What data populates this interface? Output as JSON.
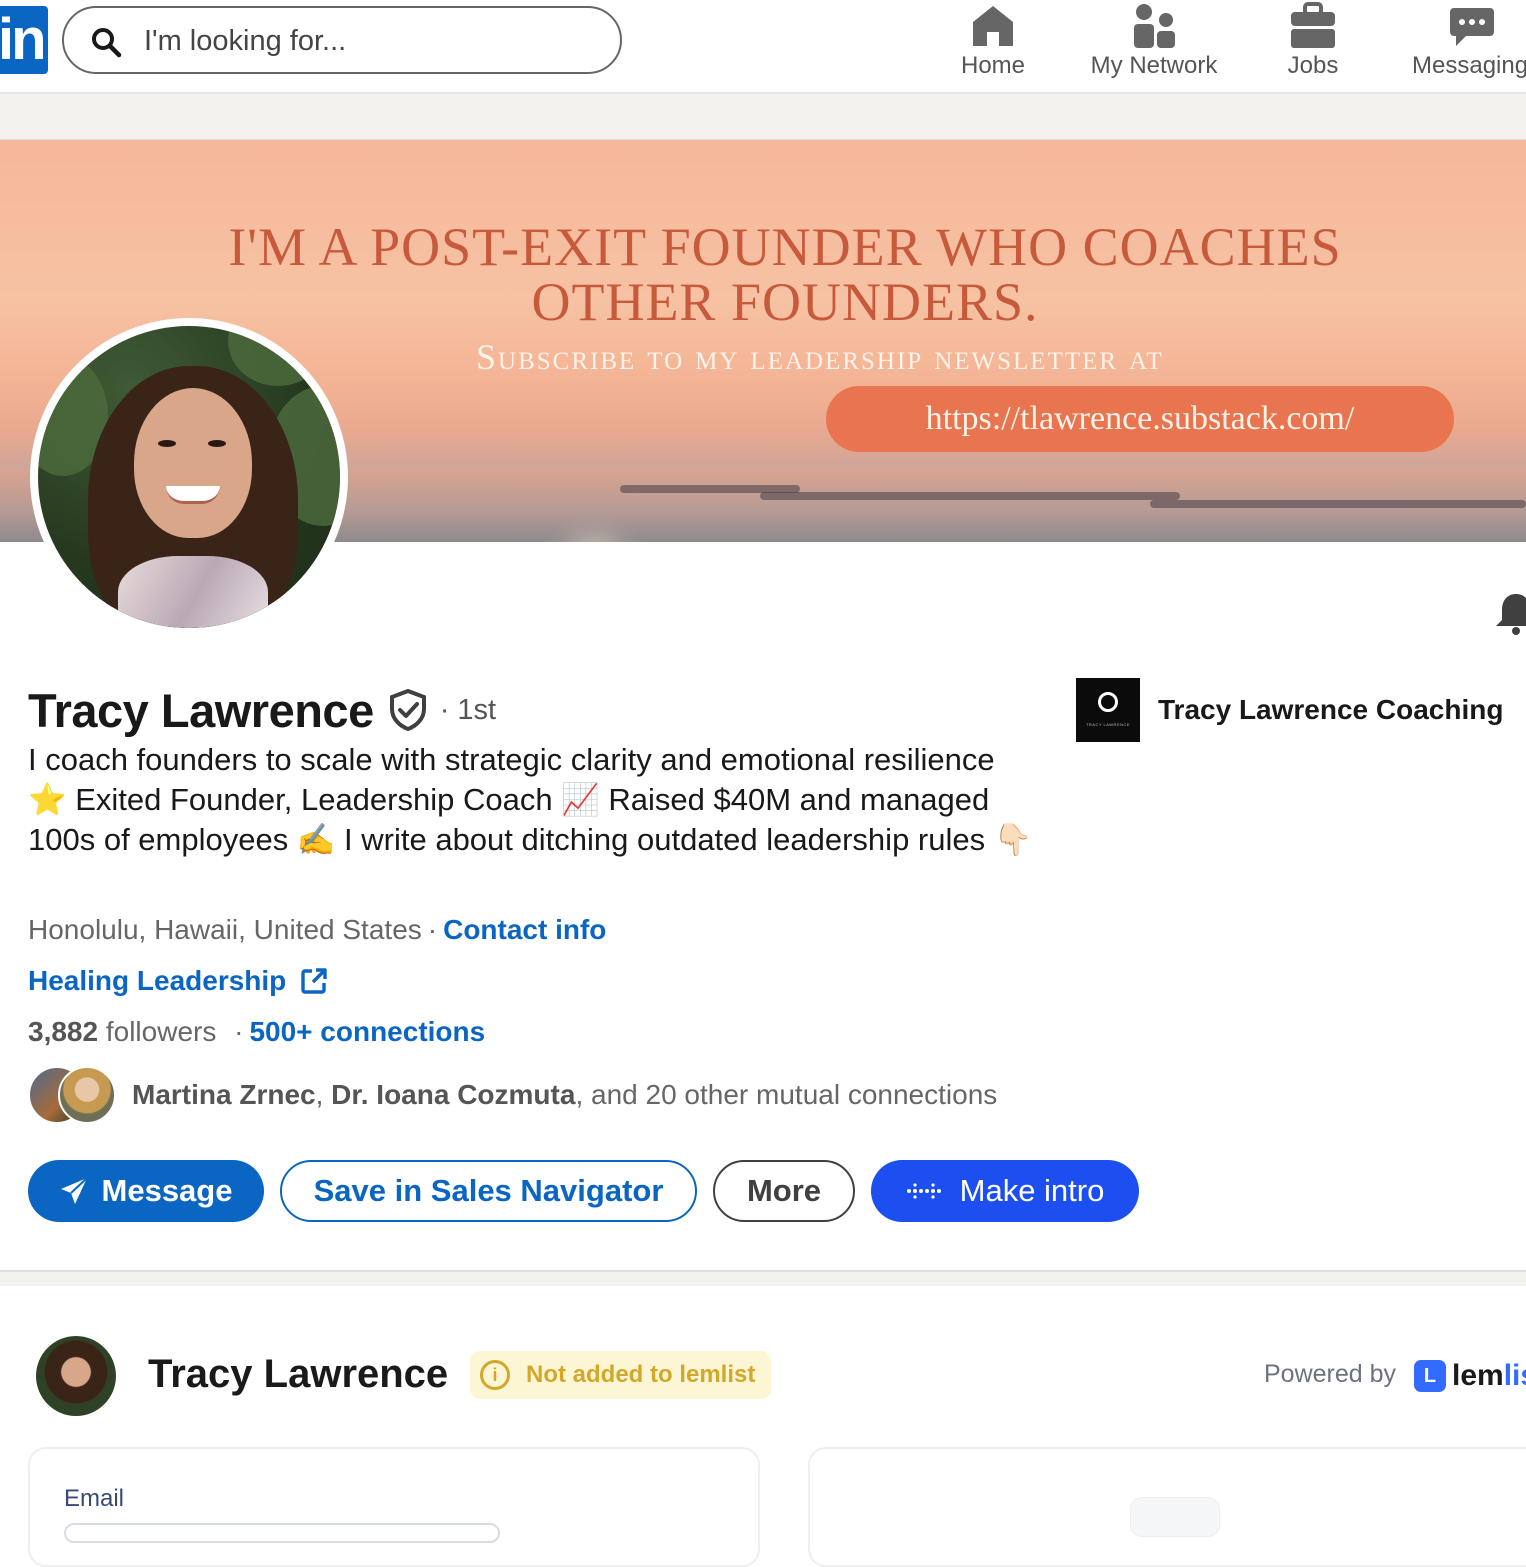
{
  "nav": {
    "logo_text": "in",
    "search_placeholder": "I'm looking for...",
    "items": [
      {
        "label": "Home",
        "icon": "home-icon"
      },
      {
        "label": "My Network",
        "icon": "people-icon"
      },
      {
        "label": "Jobs",
        "icon": "briefcase-icon"
      },
      {
        "label": "Messaging",
        "icon": "chat-bubble-icon"
      }
    ],
    "brand_color": "#0a66c2"
  },
  "banner": {
    "line1": "I'M A POST-EXIT FOUNDER WHO COACHES",
    "line2": "OTHER FOUNDERS.",
    "line3": "Subscribe to my leadership newsletter at",
    "url": "https://tlawrence.substack.com/"
  },
  "profile": {
    "name": "Tracy Lawrence",
    "degree": "· 1st",
    "headline": "I coach founders to scale with strategic clarity and emotional resilience ⭐ Exited Founder, Leadership Coach 📈 Raised $40M and managed 100s of employees ✍️ I write about ditching outdated leadership rules 👇🏻",
    "location": "Honolulu, Hawaii, United States",
    "contact_label": "Contact info",
    "website_label": "Healing Leadership",
    "followers_count": "3,882",
    "followers_word": "followers",
    "connections_label": "500+ connections",
    "mutual_names_1": "Martina Zrnec",
    "mutual_names_2": "Dr. Ioana Cozmuta",
    "mutual_rest": ", and 20 other mutual connections",
    "company_logo_text": "TRACY LAWRENCE",
    "company_name": "Tracy Lawrence Coaching"
  },
  "actions": {
    "message": "Message",
    "save": "Save in Sales Navigator",
    "more": "More",
    "intro": "Make intro"
  },
  "lemlist": {
    "name": "Tracy Lawrence",
    "badge": "Not added to lemlist",
    "badge_icon": "i",
    "powered_by": "Powered by",
    "logo_icon": "L",
    "logo_text_a": "lem",
    "logo_text_b": "list",
    "email_label": "Email",
    "accent_color": "#316bff",
    "badge_color": "#d3a82a"
  }
}
